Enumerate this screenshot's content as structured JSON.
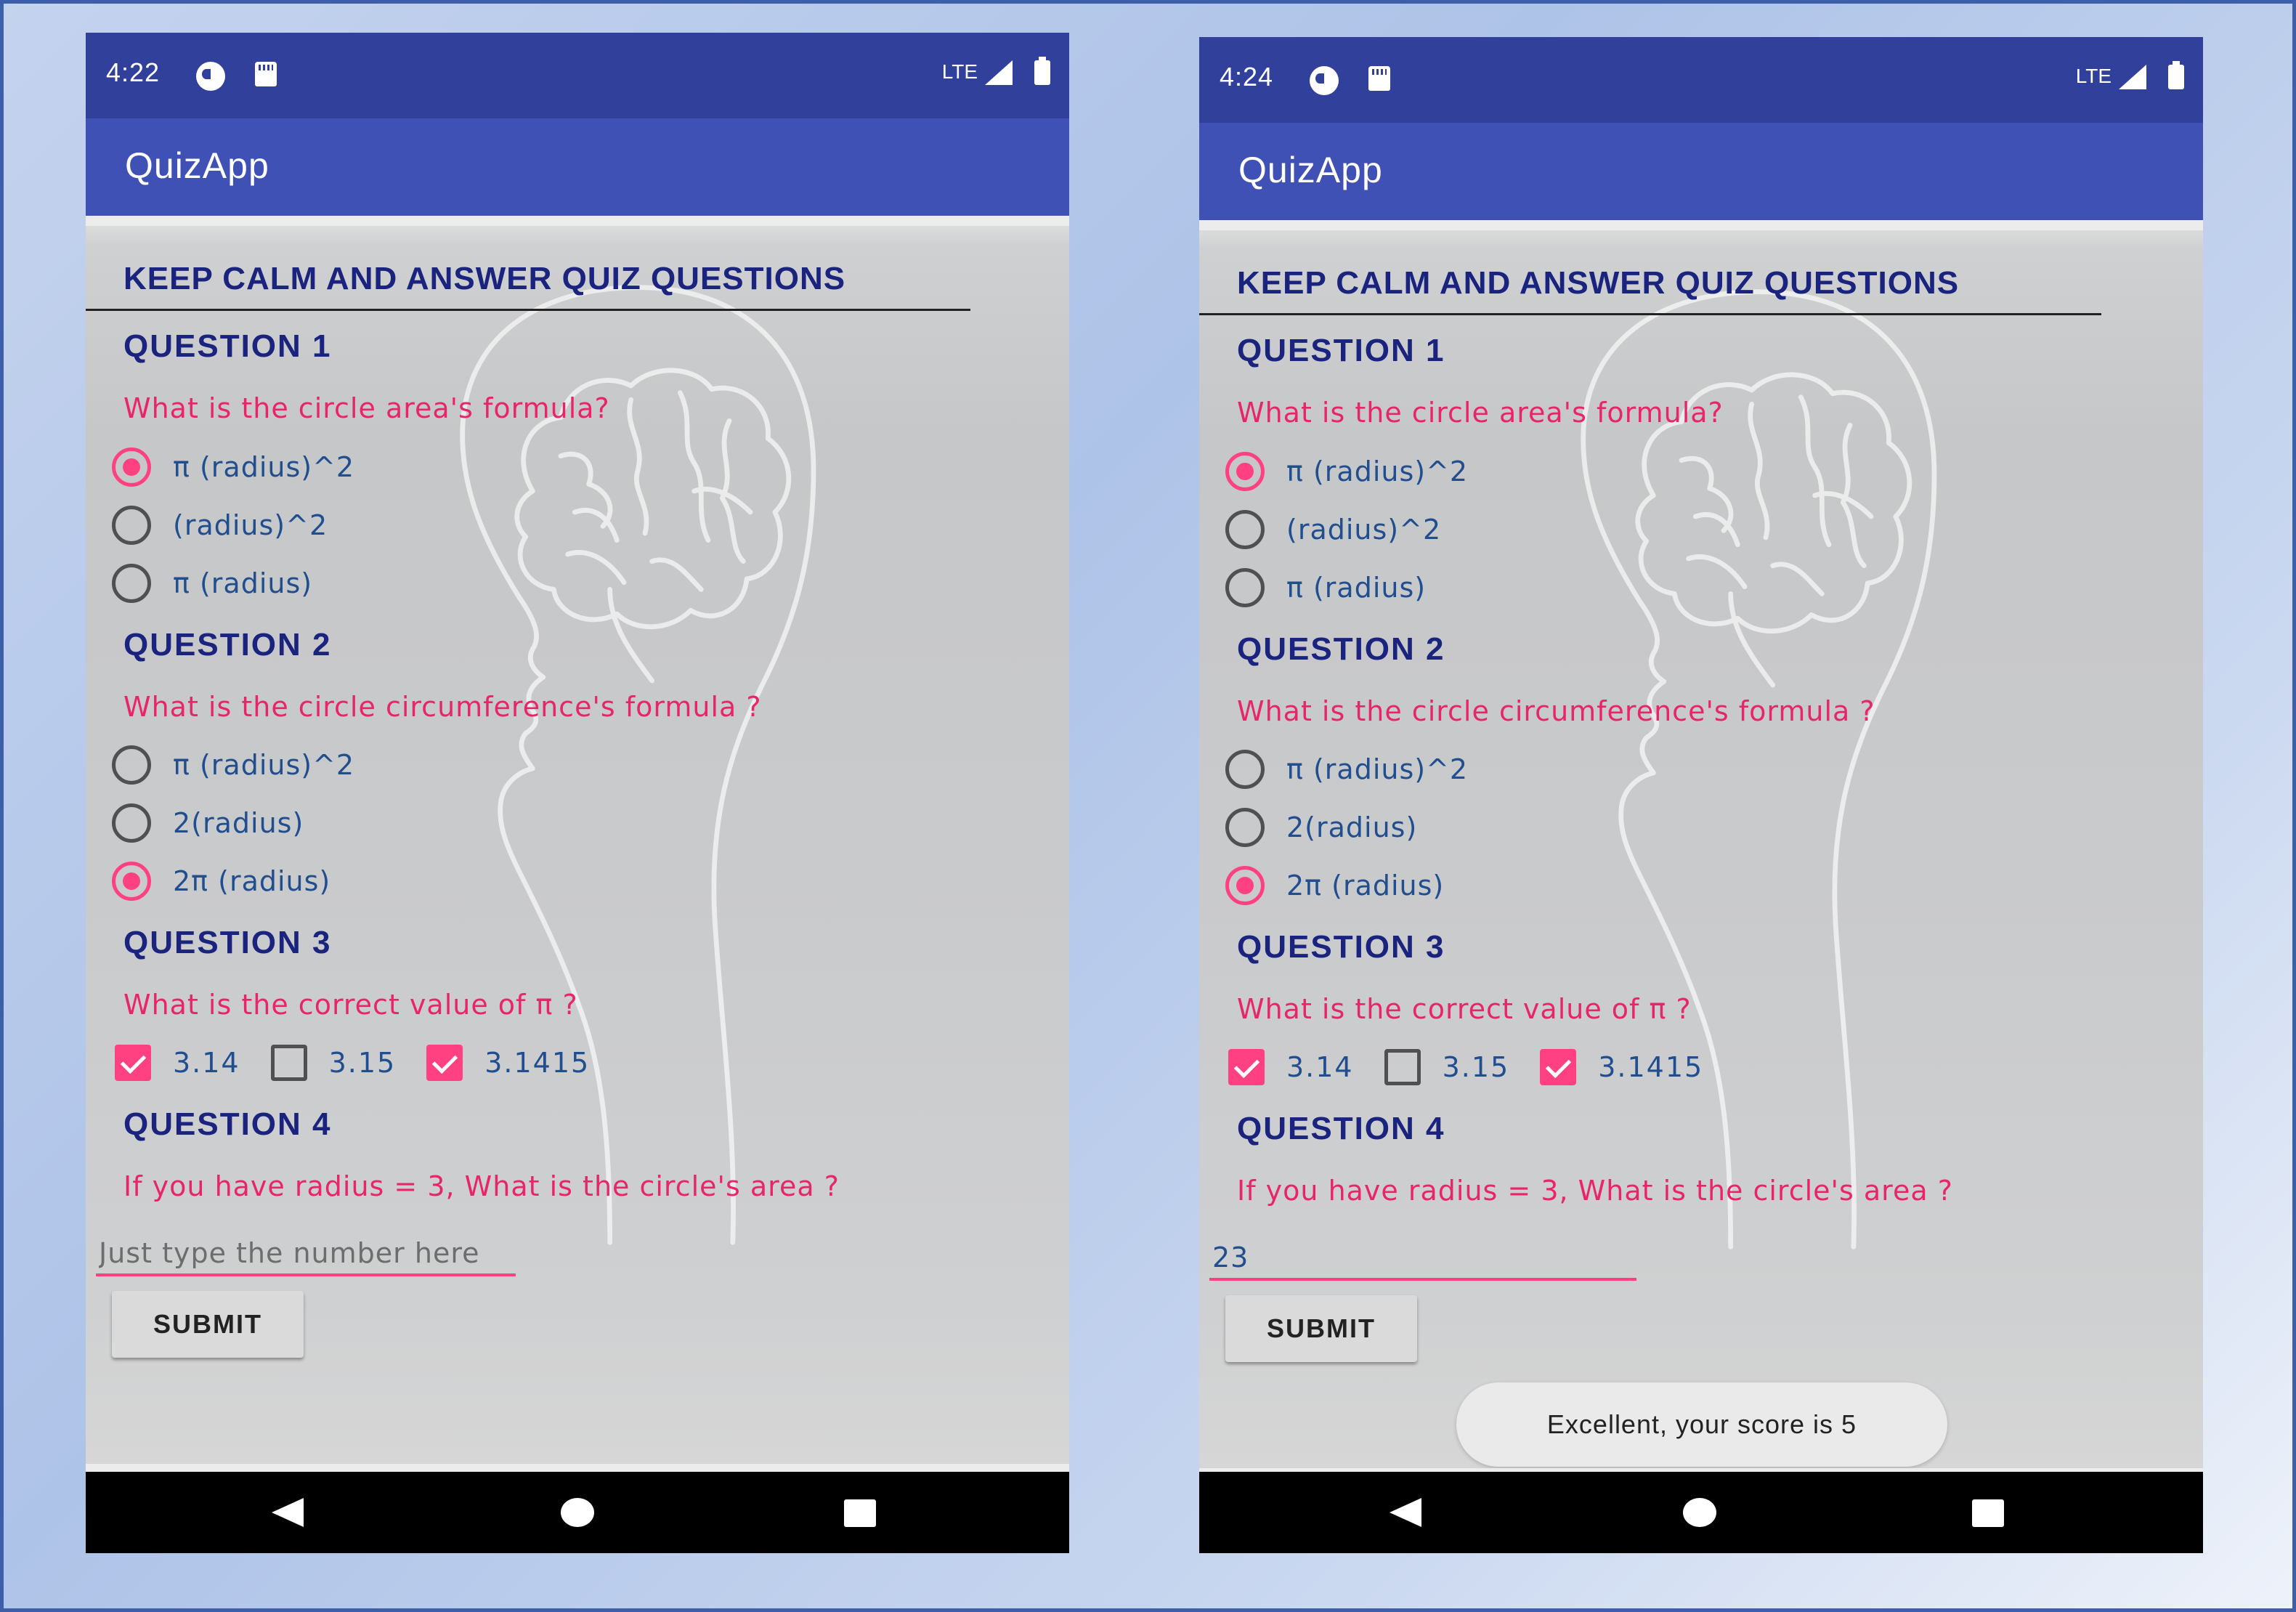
{
  "screens": [
    {
      "status": {
        "time": "4:22",
        "network": "LTE"
      },
      "app_title": "QuizApp",
      "heading": "KEEP CALM AND ANSWER QUIZ QUESTIONS",
      "questions": [
        {
          "title": "QUESTION 1",
          "text": "What is the circle area's formula?",
          "options": [
            "π (radius)^2",
            "(radius)^2",
            "π (radius)"
          ],
          "selected": 0
        },
        {
          "title": "QUESTION 2",
          "text": "What is the circle circumference's formula ?",
          "options": [
            "π (radius)^2",
            "2(radius)",
            "2π (radius)"
          ],
          "selected": 2
        },
        {
          "title": "QUESTION 3",
          "text": "What is the correct value of π ?",
          "checks": [
            {
              "label": "3.14",
              "checked": true
            },
            {
              "label": "3.15",
              "checked": false
            },
            {
              "label": "3.1415",
              "checked": true
            }
          ]
        },
        {
          "title": "QUESTION 4",
          "text": "If you have radius = 3, What is the circle's area ?"
        }
      ],
      "answer": {
        "value": "",
        "placeholder": "Just type the number here"
      },
      "submit_label": "SUBMIT",
      "toast": ""
    },
    {
      "status": {
        "time": "4:24",
        "network": "LTE"
      },
      "app_title": "QuizApp",
      "heading": "KEEP CALM AND ANSWER QUIZ QUESTIONS",
      "questions": [
        {
          "title": "QUESTION 1",
          "text": "What is the circle area's formula?",
          "options": [
            "π (radius)^2",
            "(radius)^2",
            "π (radius)"
          ],
          "selected": 0
        },
        {
          "title": "QUESTION 2",
          "text": "What is the circle circumference's formula ?",
          "options": [
            "π (radius)^2",
            "2(radius)",
            "2π (radius)"
          ],
          "selected": 2
        },
        {
          "title": "QUESTION 3",
          "text": "What is the correct value of π ?",
          "checks": [
            {
              "label": "3.14",
              "checked": true
            },
            {
              "label": "3.15",
              "checked": false
            },
            {
              "label": "3.1415",
              "checked": true
            }
          ]
        },
        {
          "title": "QUESTION 4",
          "text": "If you have radius = 3, What is the circle's area ?"
        }
      ],
      "answer": {
        "value": "23",
        "placeholder": ""
      },
      "submit_label": "SUBMIT",
      "toast": "Excellent, your score is 5"
    }
  ],
  "colors": {
    "status_bar": "#30409b",
    "app_bar": "#3f51b5",
    "accent": "#ff4081",
    "heading": "#1a237e",
    "question_text": "#e8256a",
    "option_text": "#214e8f"
  },
  "icons": [
    "data-saver-icon",
    "sd-card-icon",
    "signal-icon",
    "battery-icon",
    "nav-back-icon",
    "nav-home-icon",
    "nav-recents-icon"
  ]
}
